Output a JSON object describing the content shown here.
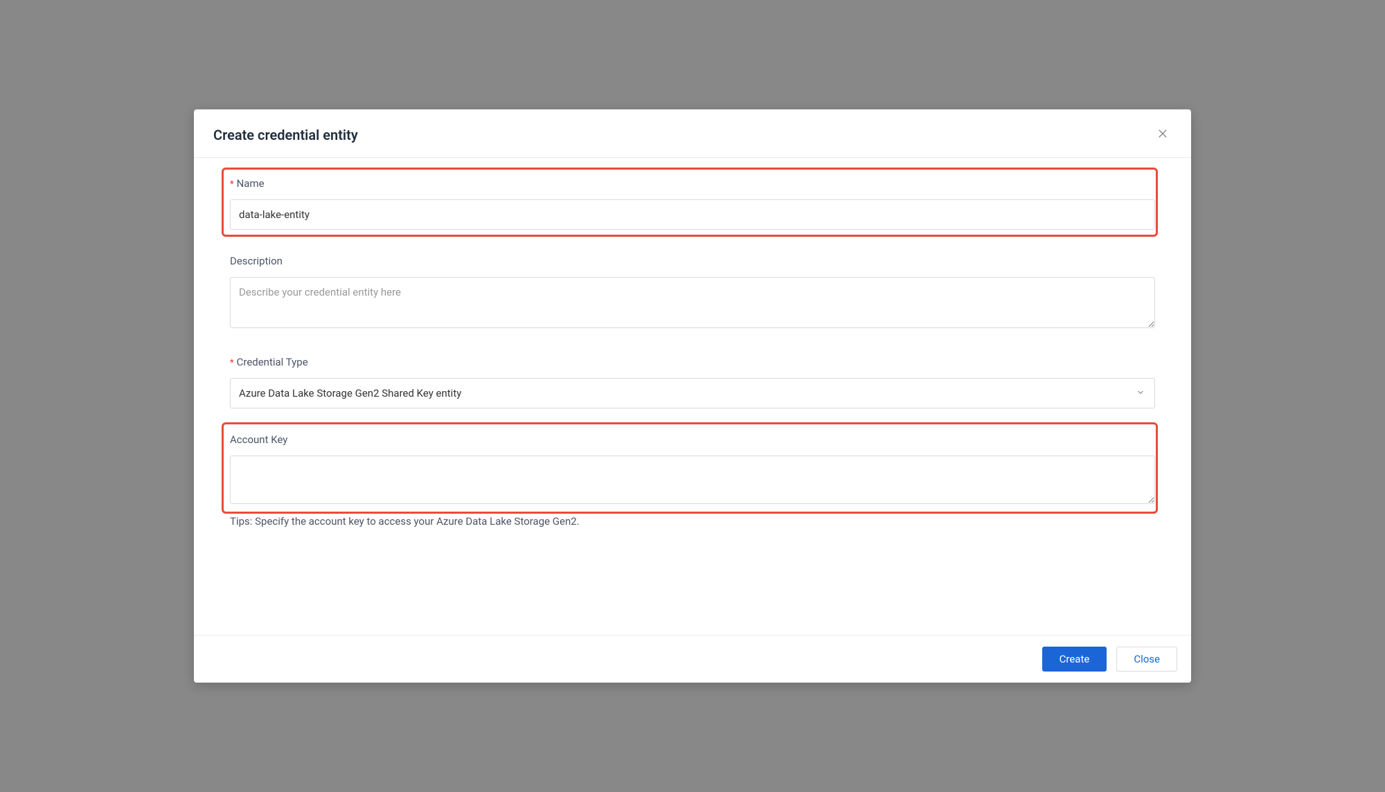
{
  "modal": {
    "title": "Create credential entity"
  },
  "form": {
    "name": {
      "label": "Name",
      "value": "data-lake-entity",
      "required": true
    },
    "description": {
      "label": "Description",
      "placeholder": "Describe your credential entity here",
      "value": ""
    },
    "credentialType": {
      "label": "Credential Type",
      "value": "Azure Data Lake Storage Gen2 Shared Key entity",
      "required": true
    },
    "accountKey": {
      "label": "Account Key",
      "value": "",
      "tips": "Tips: Specify the account key to access your Azure Data Lake Storage Gen2."
    }
  },
  "footer": {
    "createLabel": "Create",
    "closeLabel": "Close"
  },
  "requiredMarker": "*"
}
